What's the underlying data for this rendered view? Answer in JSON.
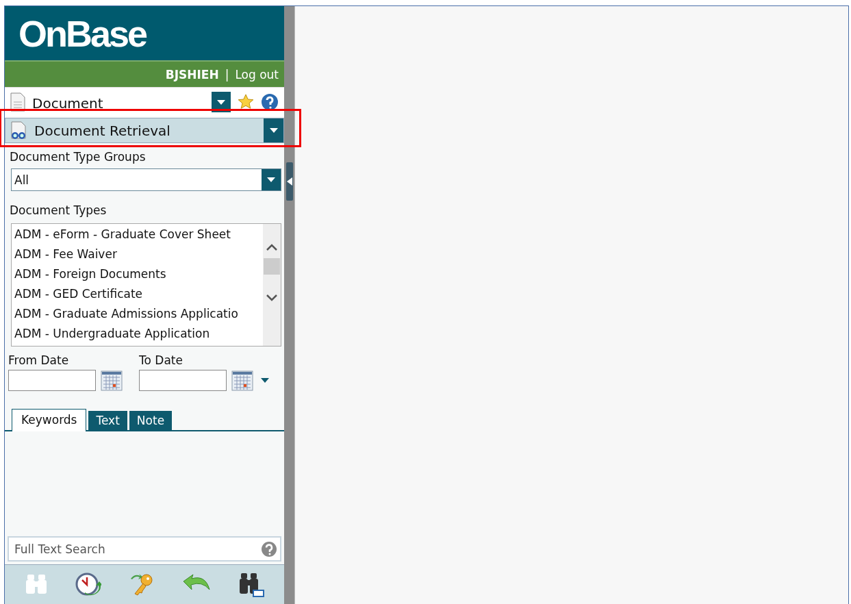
{
  "logo": "OnBase",
  "user_bar": {
    "user": "BJSHIEH",
    "separator": "|",
    "logout": "Log out"
  },
  "category": {
    "label": "Document"
  },
  "retrieval": {
    "label": "Document Retrieval",
    "highlighted": true
  },
  "type_groups": {
    "label": "Document Type Groups",
    "value": "All"
  },
  "document_types": {
    "label": "Document Types",
    "items": [
      {
        "label": "ADM - eForm - Graduate Cover Sheet",
        "selected": false
      },
      {
        "label": "ADM - Fee Waiver",
        "selected": false
      },
      {
        "label": "ADM - Foreign Documents",
        "selected": false
      },
      {
        "label": "ADM - GED Certificate",
        "selected": false
      },
      {
        "label": "ADM - Graduate Admissions Applicatio",
        "selected": false
      },
      {
        "label": "ADM - Undergraduate Application",
        "selected": false
      }
    ]
  },
  "dates": [
    {
      "label": "From Date"
    },
    {
      "label": "To Date"
    }
  ],
  "tabs": [
    {
      "label": "Keywords",
      "selected": true
    },
    {
      "label": "Text",
      "selected": false
    },
    {
      "label": "Note",
      "selected": false
    }
  ],
  "full_text_search": {
    "placeholder": "Full Text Search"
  },
  "toolbar": [
    {
      "kind": "binoculars",
      "disabled": true
    },
    {
      "kind": "history",
      "disabled": false
    },
    {
      "kind": "key",
      "disabled": false
    },
    {
      "kind": "back",
      "disabled": false
    },
    {
      "kind": "fulltext",
      "disabled": false
    }
  ]
}
